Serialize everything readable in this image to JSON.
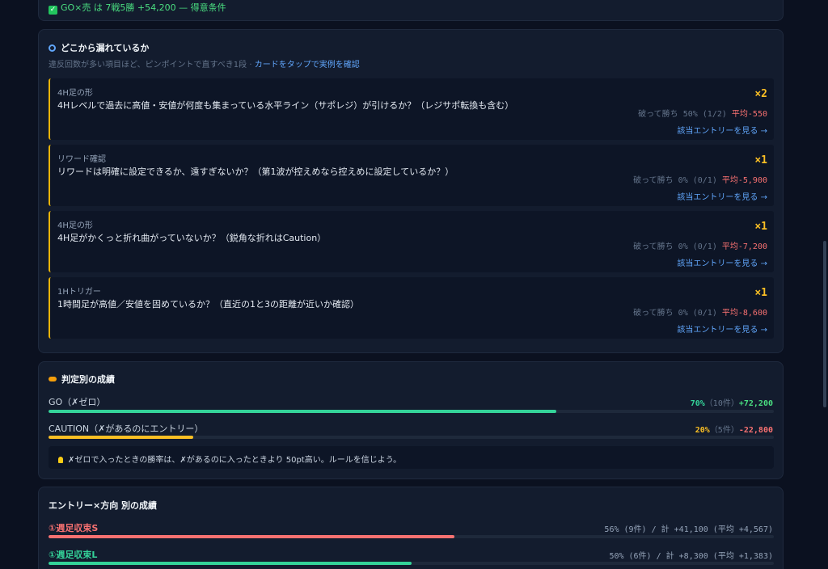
{
  "top": {
    "summary": "GO×売 は 7戦5勝 +54,200 — 得意条件"
  },
  "leaks": {
    "title": "どこから漏れているか",
    "sub_text": "違反回数が多い項目ほど、ピンポイントで直すべき1段 · ",
    "sub_link": "カードをタップで実例を確認",
    "items": [
      {
        "category": "4H足の形",
        "question": "4Hレベルで過去に高値・安値が何度も集まっている水平ライン（サポレジ）が引けるか？（レジサポ転換も含む）",
        "count": "×2",
        "stat": "破って勝ち 50% (1/2) ",
        "avg": "平均-550",
        "more": "該当エントリーを見る →"
      },
      {
        "category": "リワード確認",
        "question": "リワードは明確に設定できるか、遠すぎないか？（第1波が控えめなら控えめに設定しているか？）",
        "count": "×1",
        "stat": "破って勝ち 0% (0/1) ",
        "avg": "平均-5,900",
        "more": "該当エントリーを見る →"
      },
      {
        "category": "4H足の形",
        "question": "4H足がかくっと折れ曲がっていないか？（鋭角な折れはCaution）",
        "count": "×1",
        "stat": "破って勝ち 0% (0/1) ",
        "avg": "平均-7,200",
        "more": "該当エントリーを見る →"
      },
      {
        "category": "1Hトリガー",
        "question": "1時間足が高値／安値を固めているか？（直近の1と3の距離が近いか確認）",
        "count": "×1",
        "stat": "破って勝ち 0% (0/1) ",
        "avg": "平均-8,600",
        "more": "該当エントリーを見る →"
      }
    ]
  },
  "verdict": {
    "title": "判定別の成績",
    "rows": [
      {
        "label": "GO（✗ゼロ）",
        "pct": "70%",
        "count": "（10件）",
        "total": "+72,200",
        "win_rate": 0.7,
        "color": "#34d399",
        "total_color": "#4ade80"
      },
      {
        "label": "CAUTION（✗があるのにエントリー）",
        "pct": "20%",
        "count": "（5件）",
        "total": "-22,800",
        "win_rate": 0.2,
        "color": "#fbbf24",
        "total_color": "#f87171"
      }
    ],
    "note": "✗ゼロで入ったときの勝率は、✗があるのに入ったときより 50pt高い。ルールを信じよう。"
  },
  "direction": {
    "title": "エントリー×方向 別の成績",
    "rows": [
      {
        "label": "①週足収束S",
        "stats": "56% (9件) / 計 +41,100 (平均 +4,567)",
        "win_rate": 0.56,
        "color": "#f87171"
      },
      {
        "label": "①週足収束L",
        "stats": "50% (6件) / 計 +8,300 (平均 +1,383)",
        "win_rate": 0.5,
        "color": "#34d399"
      }
    ]
  }
}
